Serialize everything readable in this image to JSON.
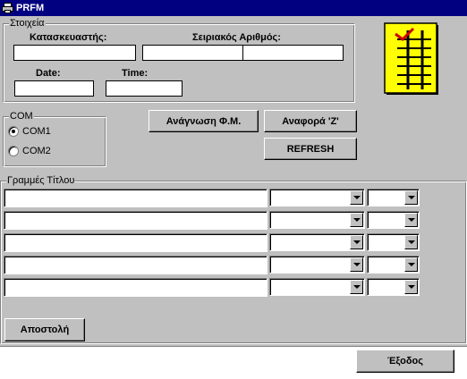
{
  "window": {
    "title": "PRFM"
  },
  "details_group": {
    "legend": "Στοιχεία",
    "manufacturer_label": "Κατασκευαστής:",
    "manufacturer_value": "",
    "serial_label": "Σειριακός Αριθμός:",
    "serial_value_1": "",
    "serial_value_2": "",
    "date_label": "Date:",
    "date_value": "",
    "time_label": "Time:",
    "time_value": ""
  },
  "com_group": {
    "legend": "COM",
    "options": [
      {
        "label": "COM1",
        "checked": true
      },
      {
        "label": "COM2",
        "checked": false
      }
    ]
  },
  "buttons": {
    "read_fm": "Ανάγνωση Φ.Μ.",
    "report_z": "Αναφορά 'Z'",
    "refresh": "REFRESH",
    "send": "Αποστολή",
    "exit": "Έξοδος"
  },
  "header_lines_group": {
    "legend": "Γραμμές Τίτλου",
    "rows": [
      {
        "text": "",
        "style": "",
        "align": ""
      },
      {
        "text": "",
        "style": "",
        "align": ""
      },
      {
        "text": "",
        "style": "",
        "align": ""
      },
      {
        "text": "",
        "style": "",
        "align": ""
      },
      {
        "text": "",
        "style": "",
        "align": ""
      }
    ]
  },
  "icons": {
    "app": "printer-icon",
    "document": "spreadsheet-document-icon"
  },
  "colors": {
    "titlebar": "#000080",
    "face": "#c0c0c0",
    "doc_fill": "#ffff00",
    "doc_mark": "#cc0000"
  }
}
